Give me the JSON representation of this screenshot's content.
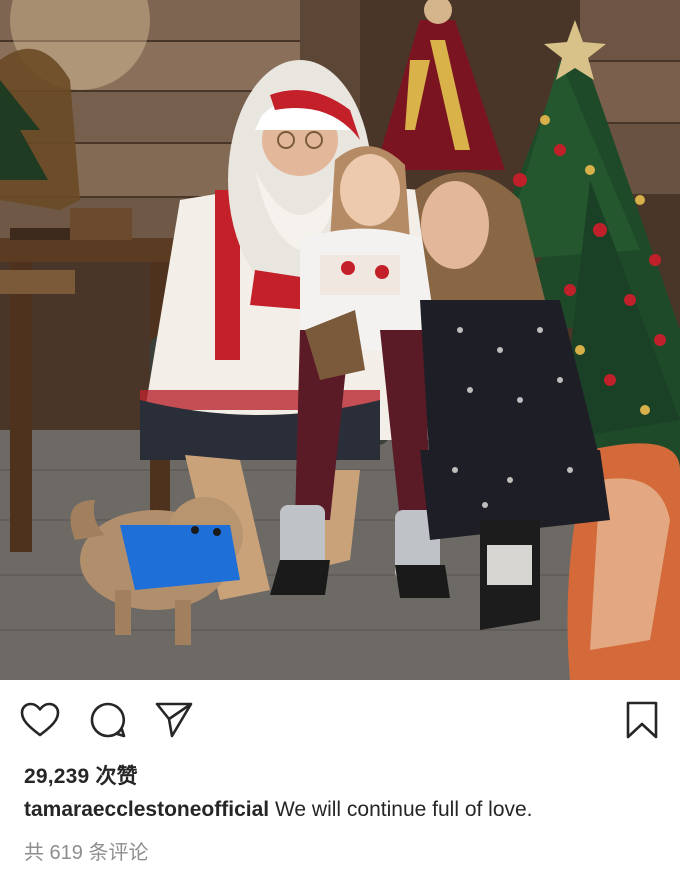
{
  "photo": {
    "alt_subject": "family-christmas-photo"
  },
  "actions": {
    "like_icon": "heart-icon",
    "comment_icon": "comment-bubble-icon",
    "share_icon": "paper-plane-icon",
    "save_icon": "bookmark-icon"
  },
  "likes": {
    "text": "29,239 次赞"
  },
  "caption": {
    "username": "tamaraecclestoneofficial",
    "text": "We will continue full of love."
  },
  "comments": {
    "text": "共 619 条评论"
  },
  "colors": {
    "text_primary": "#262626",
    "text_secondary": "#8e8e8e",
    "icon": "#262626"
  }
}
